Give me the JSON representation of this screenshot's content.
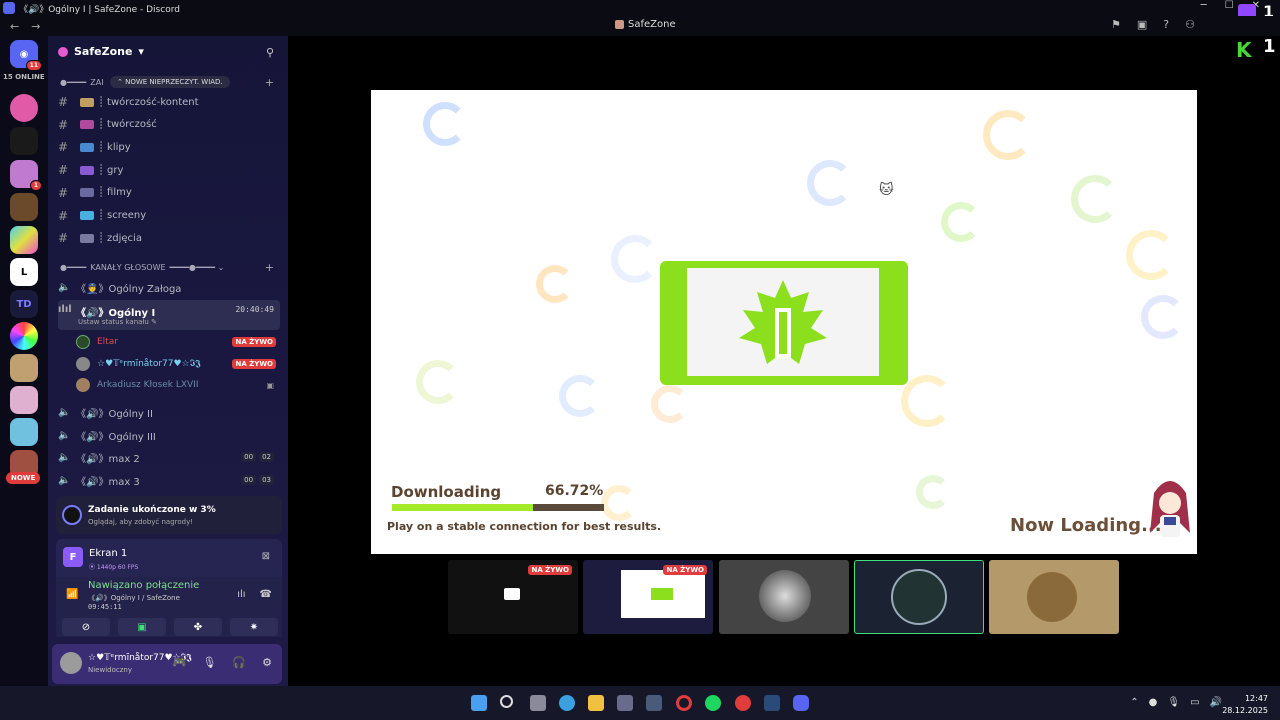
{
  "window": {
    "title": "《🔊》Ogólny I | SafeZone - Discord",
    "minimize": "─",
    "maximize": "☐",
    "close": "✕"
  },
  "nav": {
    "back": "←",
    "forward": "→",
    "title": "SafeZone"
  },
  "guilds": {
    "online": "15 ONLINE",
    "home_badge": "11",
    "badge_3": "1",
    "new_label": "NOWE"
  },
  "server": {
    "name": "SafeZone",
    "chevron": "▾"
  },
  "categories": {
    "text": {
      "label": "ZAI",
      "new_unread": "⌃ NOWE NIEPRZECZYT. WIAD."
    },
    "voice": {
      "label": "KANAŁY GŁOSOWE"
    }
  },
  "text_channels": [
    {
      "name": "twórczość-kontent",
      "color": "#c0a060"
    },
    {
      "name": "twórczość",
      "color": "#b04a9a"
    },
    {
      "name": "klipy",
      "color": "#4a8ad0"
    },
    {
      "name": "gry",
      "color": "#8a5ad0"
    },
    {
      "name": "filmy",
      "color": "#6a6aa0"
    },
    {
      "name": "screeny",
      "color": "#4ab0e0"
    },
    {
      "name": "zdjęcia",
      "color": "#7a7aa0"
    }
  ],
  "voice_channels": {
    "zaloga": "《👮》Ogólny Załoga",
    "active": {
      "name": "《🔊》Ogólny I",
      "time": "20:40:49",
      "status": "Ustaw status kanału ✎"
    },
    "members": [
      {
        "name": "Eltar",
        "color": "#e04848",
        "live": "NA ŻYWO"
      },
      {
        "name": "☆♥𝕋ᵉrmĭnåtor77♥☆𝕴𝕵",
        "color": "#7ad0f0",
        "live": "NA ŻYWO"
      },
      {
        "name": "Arkadiusz Kłosek LXVII",
        "color": "#6a8aa8",
        "live": ""
      }
    ],
    "others": [
      {
        "name": "《🔊》Ogólny II",
        "c1": "",
        "c2": ""
      },
      {
        "name": "《🔊》Ogólny III",
        "c1": "",
        "c2": ""
      },
      {
        "name": "《🔊》max 2",
        "c1": "00",
        "c2": "02"
      },
      {
        "name": "《🔊》max 3",
        "c1": "00",
        "c2": "03"
      }
    ]
  },
  "quest": {
    "title": "Zadanie ukończone w 3%",
    "sub": "Oglądaj, aby zdobyć nagrody!"
  },
  "screen": {
    "icon": "F",
    "title": "Ekran 1",
    "sub": "⦿ 1440p 60 FPS"
  },
  "voice": {
    "connected": "Nawiązano połączenie",
    "location": "《🔊》Ogólny I / SafeZone",
    "timer": "09:45:11"
  },
  "user": {
    "name": "☆♥𝕋ᵉrmĭnåtor77♥☆𝕴𝕵",
    "status": "Niewidoczny"
  },
  "stream": {
    "label": "Downloading",
    "percent_text": "66.72%",
    "progress": 0.6672,
    "hint": "Play on a stable connection for best results.",
    "loading": "Now Loading..."
  },
  "thumbs": [
    {
      "live": "NA ŻYWO"
    },
    {
      "live": "NA ŻYWO"
    },
    {
      "live": ""
    },
    {
      "live": ""
    },
    {
      "live": ""
    }
  ],
  "overlay": {
    "k": "K",
    "k_count": "1",
    "twitch_count": "1"
  },
  "clock": {
    "time": "12:47",
    "date": "28.12.2025"
  }
}
